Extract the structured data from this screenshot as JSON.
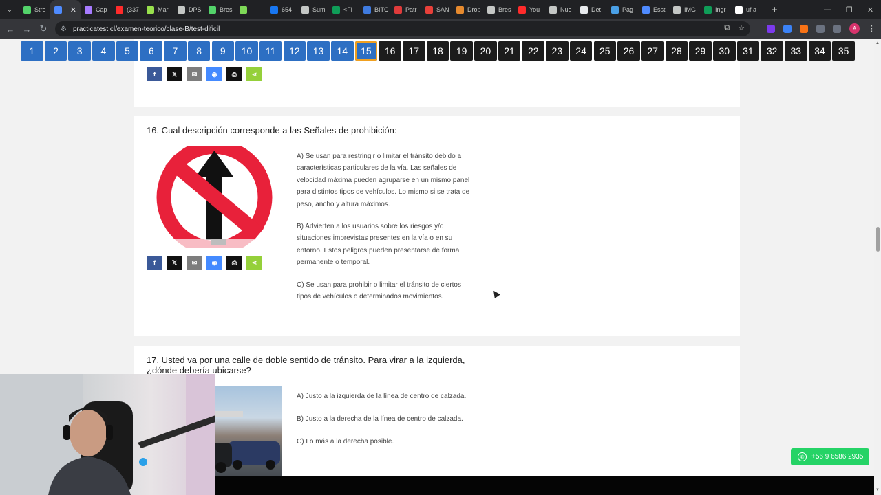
{
  "browser": {
    "tabs": [
      {
        "label": "Stre",
        "color": "#53d36a"
      },
      {
        "label": "",
        "color": "#4f8bff",
        "active": true
      },
      {
        "label": "Cap",
        "color": "#a77bff"
      },
      {
        "label": "(337",
        "color": "#ff2b2b"
      },
      {
        "label": "Mar",
        "color": "#98e04d"
      },
      {
        "label": "DPS",
        "color": "#c4c7c5"
      },
      {
        "label": "Bres",
        "color": "#53d36a"
      },
      {
        "label": "",
        "color": "#7ed957"
      },
      {
        "label": "654",
        "color": "#1877f2"
      },
      {
        "label": "Sum",
        "color": "#c4c7c5"
      },
      {
        "label": "<Fi",
        "color": "#0f9d58"
      },
      {
        "label": "BITC",
        "color": "#3f7be0"
      },
      {
        "label": "Patr",
        "color": "#e03b3b"
      },
      {
        "label": "SAN",
        "color": "#e8403a"
      },
      {
        "label": "Drop",
        "color": "#e68a2e"
      },
      {
        "label": "Bres",
        "color": "#c4c7c5"
      },
      {
        "label": "You",
        "color": "#ff2b2b"
      },
      {
        "label": "Nue",
        "color": "#c4c7c5"
      },
      {
        "label": "Det",
        "color": "#e8eaed"
      },
      {
        "label": "Pag",
        "color": "#4aa0e6"
      },
      {
        "label": "Esst",
        "color": "#4f8bff"
      },
      {
        "label": "IMG",
        "color": "#c4c7c5"
      },
      {
        "label": "Ingr",
        "color": "#0f9d58"
      },
      {
        "label": "uf a",
        "color": "#ffffff"
      }
    ],
    "url": "practicatest.cl/examen-teorico/clase-B/test-dificil",
    "profile_initial": "A"
  },
  "question_nav": {
    "buttons": [
      "1",
      "2",
      "3",
      "4",
      "5",
      "6",
      "7",
      "8",
      "9",
      "10",
      "11",
      "12",
      "13",
      "14",
      "15",
      "16",
      "17",
      "18",
      "19",
      "20",
      "21",
      "22",
      "23",
      "24",
      "25",
      "26",
      "27",
      "28",
      "29",
      "30",
      "31",
      "32",
      "33",
      "34",
      "35"
    ],
    "answered_count": 14,
    "current": "15"
  },
  "share": {
    "facebook": "f",
    "x": "𝕏",
    "email": "✉",
    "messenger": "◉",
    "print": "⎙",
    "share": "⋖"
  },
  "q16": {
    "title": "16. Cual descripción corresponde a las Señales de prohibición:",
    "options": [
      "A) Se usan para restringir o limitar el tránsito debido a características particulares de la vía. Las señales de velocidad máxima pueden agruparse en un mismo panel para distintos tipos de vehículos. Lo mismo si se trata de peso, ancho y altura máximos.",
      "B) Advierten a los usuarios sobre los riesgos y/o situaciones imprevistas presentes en la vía o en su entorno. Estos peligros pueden presentarse de forma permanente o temporal.",
      "C) Se usan para prohibir o limitar el tránsito de ciertos tipos de vehículos o determinados movimientos."
    ]
  },
  "q17": {
    "title": "17. Usted va por una calle de doble sentido de tránsito. Para virar a la izquierda, ¿dónde debería ubicarse?",
    "options": [
      "A) Justo a la izquierda de la línea de centro de calzada.",
      "B) Justo a la derecha de la línea de centro de calzada.",
      "C) Lo más a la derecha posible."
    ]
  },
  "whatsapp": {
    "number": "+56 9 6586 2935"
  }
}
